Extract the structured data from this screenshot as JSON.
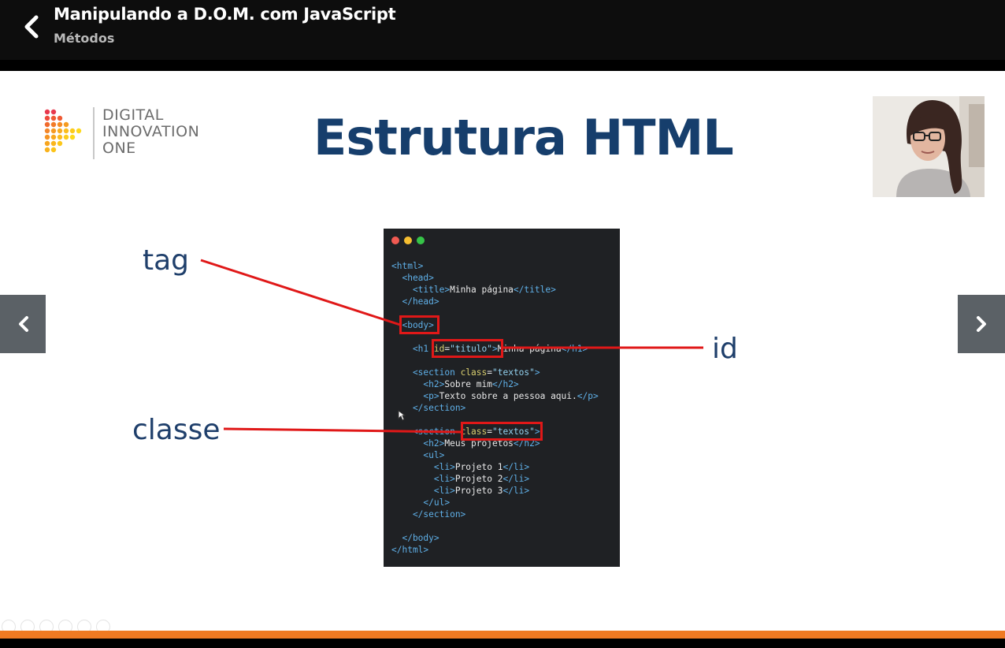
{
  "header": {
    "title": "Manipulando a D.O.M. com JavaScript",
    "subtitle": "Métodos"
  },
  "slide": {
    "logo_lines": [
      "DIGITAL",
      "INNOVATION",
      "ONE"
    ],
    "title": "Estrutura HTML",
    "labels": {
      "tag": "tag",
      "id": "id",
      "classe": "classe"
    },
    "code_lines": [
      [
        {
          "t": "<html>",
          "c": "tg"
        }
      ],
      [
        {
          "t": "  <head>",
          "c": "tg"
        }
      ],
      [
        {
          "t": "    <title>",
          "c": "tg"
        },
        {
          "t": "Minha página"
        },
        {
          "t": "</title>",
          "c": "tg"
        }
      ],
      [
        {
          "t": "  </head>",
          "c": "tg"
        }
      ],
      [],
      [
        {
          "t": "  <body>",
          "c": "tg"
        }
      ],
      [],
      [
        {
          "t": "    <h1 ",
          "c": "tg"
        },
        {
          "t": "id",
          "c": "at"
        },
        {
          "t": "="
        },
        {
          "t": "\"titulo\"",
          "c": "st"
        },
        {
          "t": ">",
          "c": "tg"
        },
        {
          "t": "Minha página"
        },
        {
          "t": "</h1>",
          "c": "tg"
        }
      ],
      [],
      [
        {
          "t": "    <section ",
          "c": "tg"
        },
        {
          "t": "class",
          "c": "at"
        },
        {
          "t": "="
        },
        {
          "t": "\"textos\"",
          "c": "st"
        },
        {
          "t": ">",
          "c": "tg"
        }
      ],
      [
        {
          "t": "      <h2>",
          "c": "tg"
        },
        {
          "t": "Sobre mim"
        },
        {
          "t": "</h2>",
          "c": "tg"
        }
      ],
      [
        {
          "t": "      <p>",
          "c": "tg"
        },
        {
          "t": "Texto sobre a pessoa aqui."
        },
        {
          "t": "</p>",
          "c": "tg"
        }
      ],
      [
        {
          "t": "    </section>",
          "c": "tg"
        }
      ],
      [],
      [
        {
          "t": "    <section ",
          "c": "tg"
        },
        {
          "t": "class",
          "c": "at"
        },
        {
          "t": "="
        },
        {
          "t": "\"textos\"",
          "c": "st"
        },
        {
          "t": ">",
          "c": "tg"
        }
      ],
      [
        {
          "t": "      <h2>",
          "c": "tg"
        },
        {
          "t": "Meus projetos"
        },
        {
          "t": "</h2>",
          "c": "tg"
        }
      ],
      [
        {
          "t": "      <ul>",
          "c": "tg"
        }
      ],
      [
        {
          "t": "        <li>",
          "c": "tg"
        },
        {
          "t": "Projeto 1"
        },
        {
          "t": "</li>",
          "c": "tg"
        }
      ],
      [
        {
          "t": "        <li>",
          "c": "tg"
        },
        {
          "t": "Projeto 2"
        },
        {
          "t": "</li>",
          "c": "tg"
        }
      ],
      [
        {
          "t": "        <li>",
          "c": "tg"
        },
        {
          "t": "Projeto 3"
        },
        {
          "t": "</li>",
          "c": "tg"
        }
      ],
      [
        {
          "t": "      </ul>",
          "c": "tg"
        }
      ],
      [
        {
          "t": "    </section>",
          "c": "tg"
        }
      ],
      [],
      [
        {
          "t": "  </body>",
          "c": "tg"
        }
      ],
      [
        {
          "t": "</html>",
          "c": "tg"
        }
      ]
    ]
  },
  "nav": {
    "prev_icon": "chevron-left-icon",
    "next_icon": "chevron-right-icon"
  },
  "colors": {
    "accent_orange": "#f07a22",
    "slide_title": "#163e6c",
    "highlight_red": "#e01818",
    "code_bg": "#1f2124"
  }
}
